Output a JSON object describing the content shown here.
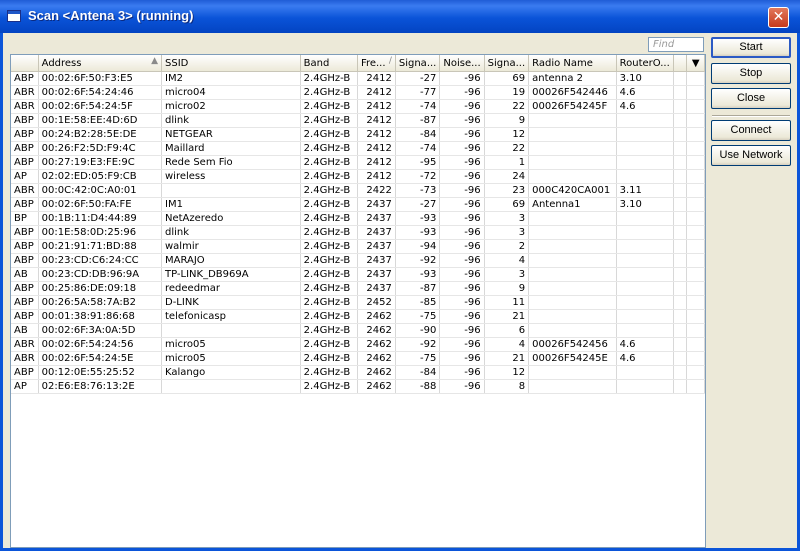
{
  "window": {
    "title": "Scan <Antena 3> (running)",
    "close_glyph": "✕"
  },
  "find": {
    "placeholder": "Find"
  },
  "buttons": {
    "start": "Start",
    "stop": "Stop",
    "close": "Close",
    "connect": "Connect",
    "use_network": "Use Network"
  },
  "columns": [
    "Address",
    "SSID",
    "Band",
    "Fre...",
    "Signa...",
    "Noise...",
    "Signa...",
    "Radio Name",
    "RouterO..."
  ],
  "rows": [
    [
      "ABP",
      "00:02:6F:50:F3:E5",
      "IM2",
      "2.4GHz-B",
      "2412",
      "-27",
      "-96",
      "69",
      "antenna 2",
      "3.10"
    ],
    [
      "ABR",
      "00:02:6F:54:24:46",
      "micro04",
      "2.4GHz-B",
      "2412",
      "-77",
      "-96",
      "19",
      "00026F542446",
      "4.6"
    ],
    [
      "ABR",
      "00:02:6F:54:24:5F",
      "micro02",
      "2.4GHz-B",
      "2412",
      "-74",
      "-96",
      "22",
      "00026F54245F",
      "4.6"
    ],
    [
      "ABP",
      "00:1E:58:EE:4D:6D",
      "dlink",
      "2.4GHz-B",
      "2412",
      "-87",
      "-96",
      "9",
      "",
      ""
    ],
    [
      "ABP",
      "00:24:B2:28:5E:DE",
      "NETGEAR",
      "2.4GHz-B",
      "2412",
      "-84",
      "-96",
      "12",
      "",
      ""
    ],
    [
      "ABP",
      "00:26:F2:5D:F9:4C",
      "Maillard",
      "2.4GHz-B",
      "2412",
      "-74",
      "-96",
      "22",
      "",
      ""
    ],
    [
      "ABP",
      "00:27:19:E3:FE:9C",
      "Rede Sem Fio",
      "2.4GHz-B",
      "2412",
      "-95",
      "-96",
      "1",
      "",
      ""
    ],
    [
      "AP",
      "02:02:ED:05:F9:CB",
      "wireless",
      "2.4GHz-B",
      "2412",
      "-72",
      "-96",
      "24",
      "",
      ""
    ],
    [
      "ABR",
      "00:0C:42:0C:A0:01",
      "",
      "2.4GHz-B",
      "2422",
      "-73",
      "-96",
      "23",
      "000C420CA001",
      "3.11"
    ],
    [
      "ABP",
      "00:02:6F:50:FA:FE",
      "IM1",
      "2.4GHz-B",
      "2437",
      "-27",
      "-96",
      "69",
      "Antenna1",
      "3.10"
    ],
    [
      "BP",
      "00:1B:11:D4:44:89",
      "NetAzeredo",
      "2.4GHz-B",
      "2437",
      "-93",
      "-96",
      "3",
      "",
      ""
    ],
    [
      "ABP",
      "00:1E:58:0D:25:96",
      "dlink",
      "2.4GHz-B",
      "2437",
      "-93",
      "-96",
      "3",
      "",
      ""
    ],
    [
      "ABP",
      "00:21:91:71:BD:88",
      "walmir",
      "2.4GHz-B",
      "2437",
      "-94",
      "-96",
      "2",
      "",
      ""
    ],
    [
      "ABP",
      "00:23:CD:C6:24:CC",
      "MARAJO",
      "2.4GHz-B",
      "2437",
      "-92",
      "-96",
      "4",
      "",
      ""
    ],
    [
      "AB",
      "00:23:CD:DB:96:9A",
      "TP-LINK_DB969A",
      "2.4GHz-B",
      "2437",
      "-93",
      "-96",
      "3",
      "",
      ""
    ],
    [
      "ABP",
      "00:25:86:DE:09:18",
      "redeedmar",
      "2.4GHz-B",
      "2437",
      "-87",
      "-96",
      "9",
      "",
      ""
    ],
    [
      "ABP",
      "00:26:5A:58:7A:B2",
      "D-LINK",
      "2.4GHz-B",
      "2452",
      "-85",
      "-96",
      "11",
      "",
      ""
    ],
    [
      "ABP",
      "00:01:38:91:86:68",
      "telefonicasp",
      "2.4GHz-B",
      "2462",
      "-75",
      "-96",
      "21",
      "",
      ""
    ],
    [
      "AB",
      "00:02:6F:3A:0A:5D",
      "",
      "2.4GHz-B",
      "2462",
      "-90",
      "-96",
      "6",
      "",
      ""
    ],
    [
      "ABR",
      "00:02:6F:54:24:56",
      "micro05",
      "2.4GHz-B",
      "2462",
      "-92",
      "-96",
      "4",
      "00026F542456",
      "4.6"
    ],
    [
      "ABR",
      "00:02:6F:54:24:5E",
      "micro05",
      "2.4GHz-B",
      "2462",
      "-75",
      "-96",
      "21",
      "00026F54245E",
      "4.6"
    ],
    [
      "ABP",
      "00:12:0E:55:25:52",
      "Kalango",
      "2.4GHz-B",
      "2462",
      "-84",
      "-96",
      "12",
      "",
      ""
    ],
    [
      "AP",
      "02:E6:E8:76:13:2E",
      "",
      "2.4GHz-B",
      "2462",
      "-88",
      "-96",
      "8",
      "",
      ""
    ]
  ]
}
